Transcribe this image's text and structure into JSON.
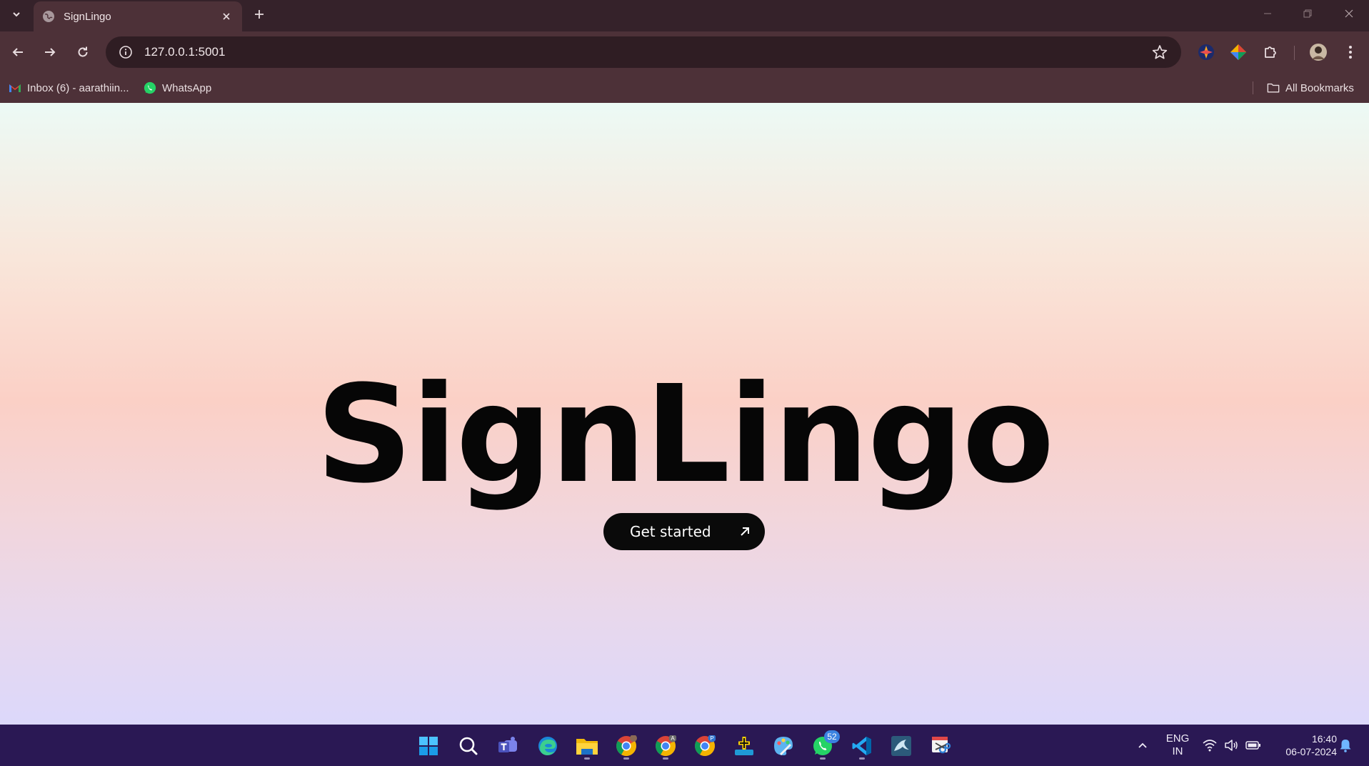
{
  "browser": {
    "tab": {
      "title": "SignLingo"
    },
    "address": {
      "url": "127.0.0.1:5001"
    },
    "bookmarks": [
      {
        "label": "Inbox (6) - aarathiin...",
        "icon": "gmail-icon"
      },
      {
        "label": "WhatsApp",
        "icon": "whatsapp-icon"
      }
    ],
    "all_bookmarks_label": "All Bookmarks"
  },
  "page": {
    "brand": "SignLingo",
    "cta_label": "Get started",
    "cta_icon": "arrow-up-right-icon",
    "colors": {
      "top": "#ecfaf5",
      "middle": "#fbd0c6",
      "bottom": "#dcd8fb",
      "button": "#0a0a0a"
    }
  },
  "taskbar": {
    "apps": [
      {
        "name": "start",
        "icon": "windows-start-icon"
      },
      {
        "name": "search",
        "icon": "search-icon"
      },
      {
        "name": "teams",
        "icon": "teams-icon"
      },
      {
        "name": "edge",
        "icon": "edge-icon"
      },
      {
        "name": "file-explorer",
        "icon": "folder-icon"
      },
      {
        "name": "chrome-profile-1",
        "icon": "chrome-icon"
      },
      {
        "name": "chrome-profile-2",
        "icon": "chrome-icon",
        "profile_letter": "A"
      },
      {
        "name": "chrome-profile-3",
        "icon": "chrome-icon",
        "profile_letter": "P"
      },
      {
        "name": "app-plus",
        "icon": "plus-app-icon"
      },
      {
        "name": "paint",
        "icon": "paint-icon"
      },
      {
        "name": "whatsapp",
        "icon": "whatsapp-icon",
        "badge": "52"
      },
      {
        "name": "vscode",
        "icon": "vscode-icon"
      },
      {
        "name": "mysql-workbench",
        "icon": "dolphin-icon"
      },
      {
        "name": "snipping-tool",
        "icon": "scissors-icon"
      }
    ],
    "tray": {
      "language": "ENG",
      "region": "IN",
      "time": "16:40",
      "date": "06-07-2024"
    }
  }
}
